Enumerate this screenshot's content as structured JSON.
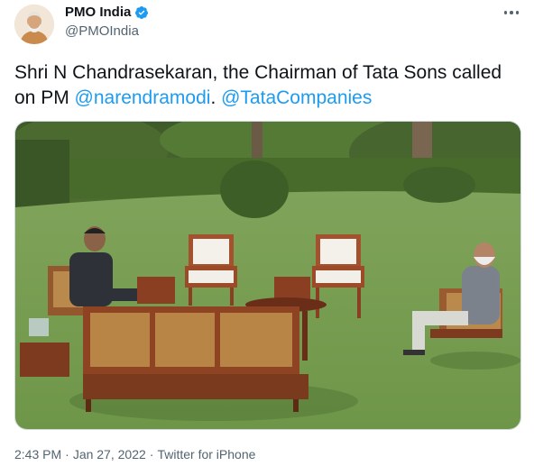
{
  "author": {
    "name": "PMO India",
    "handle": "@PMOIndia",
    "verified": true,
    "avatar_icon": "profile-photo"
  },
  "tweet": {
    "text_before": "Shri N Chandrasekaran, the Chairman of Tata Sons called on PM ",
    "mention_1": "@narendramodi",
    "text_mid": ". ",
    "mention_2": "@TataCompanies"
  },
  "media": {
    "description_icon": "photo-garden-meeting"
  },
  "meta": {
    "time": "2:43 PM",
    "separator": "·",
    "date": "Jan 27, 2022",
    "source": "Twitter for iPhone"
  },
  "colors": {
    "link": "#1d9bf0",
    "verified": "#1d9bf0",
    "secondary_text": "#536471"
  }
}
